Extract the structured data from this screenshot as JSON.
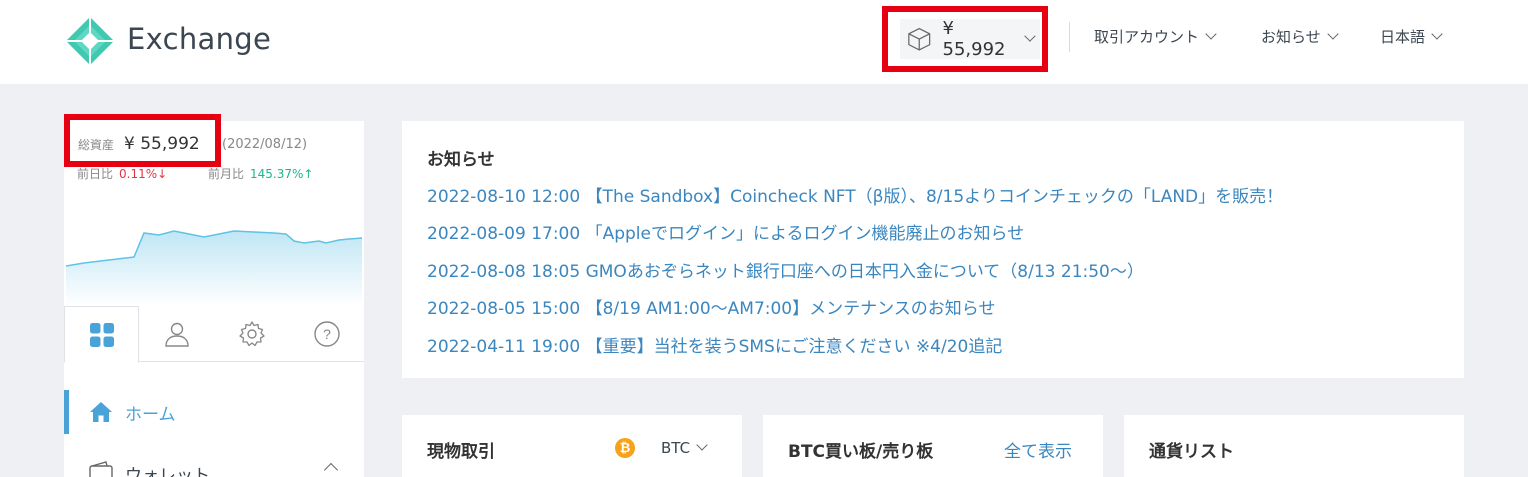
{
  "header": {
    "logo_text": "Exchange",
    "balance": "¥ 55,992",
    "nav": [
      {
        "label": "取引アカウント"
      },
      {
        "label": "お知らせ"
      },
      {
        "label": "日本語"
      }
    ]
  },
  "sidebar": {
    "total_label": "総資産",
    "total_value": "¥ 55,992",
    "total_date": "(2022/08/12)",
    "day_label": "前日比",
    "day_value": "0.11%↓",
    "month_label": "前月比",
    "month_value": "145.37%↑",
    "menu": [
      {
        "label": "ホーム"
      },
      {
        "label": "ウォレット"
      }
    ]
  },
  "news": {
    "title": "お知らせ",
    "items": [
      {
        "text": "2022-08-10 12:00 【The Sandbox】Coincheck NFT（β版）、8/15よりコインチェックの「LAND」を販売！"
      },
      {
        "text": "2022-08-09 17:00 「Appleでログイン」によるログイン機能廃止のお知らせ"
      },
      {
        "text": "2022-08-08 18:05 GMOあおぞらネット銀行口座への日本円入金について（8/13 21:50〜）"
      },
      {
        "text": "2022-08-05 15:00 【8/19 AM1:00〜AM7:00】メンテナンスのお知らせ"
      },
      {
        "text": "2022-04-11 19:00 【重要】当社を装うSMSにご注意ください ※4/20追記"
      }
    ]
  },
  "cards": {
    "spot_title": "現物取引",
    "coin": "BTC",
    "coin_symbol": "₿",
    "orderbook_title": "BTC買い板/売り板",
    "show_all": "全て表示",
    "currency_title": "通貨リスト"
  },
  "colors": {
    "accent": "#4aa3d8",
    "link": "#3a86bf",
    "highlight": "#e60012",
    "down": "#e8334a",
    "up": "#19b78c"
  }
}
